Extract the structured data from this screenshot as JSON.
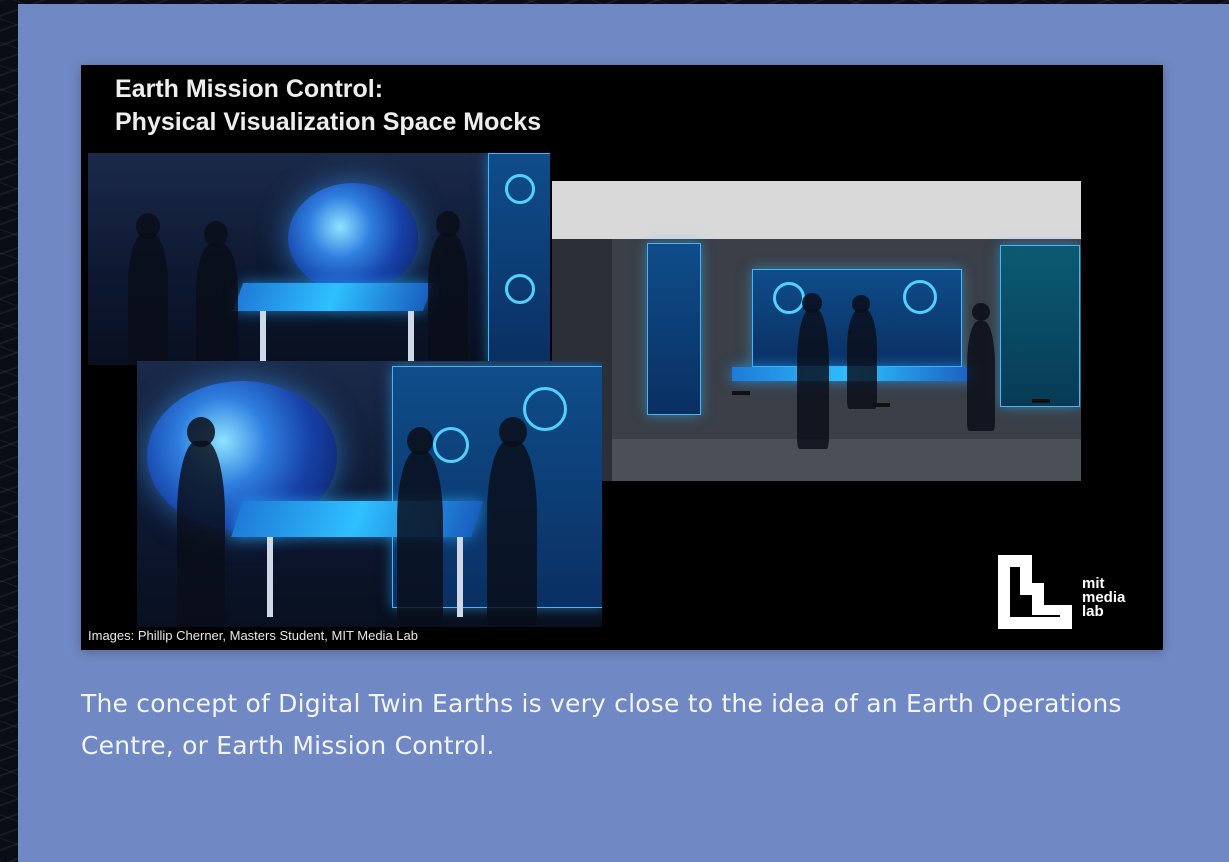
{
  "slide": {
    "title_line1": "Earth Mission Control:",
    "title_line2": "Physical Visualization Space Mocks",
    "credit": "Images: Phillip Cherner, Masters Student, MIT Media Lab",
    "logo": {
      "line1": "mit",
      "line2": "media",
      "line3": "lab"
    }
  },
  "caption": "The concept of Digital Twin Earths is very close to the idea of an Earth Operations Centre, or Earth Mission Control.",
  "colors": {
    "card_background": "#7088c4",
    "slide_background": "#000000",
    "caption_text": "#f3f5fb"
  }
}
